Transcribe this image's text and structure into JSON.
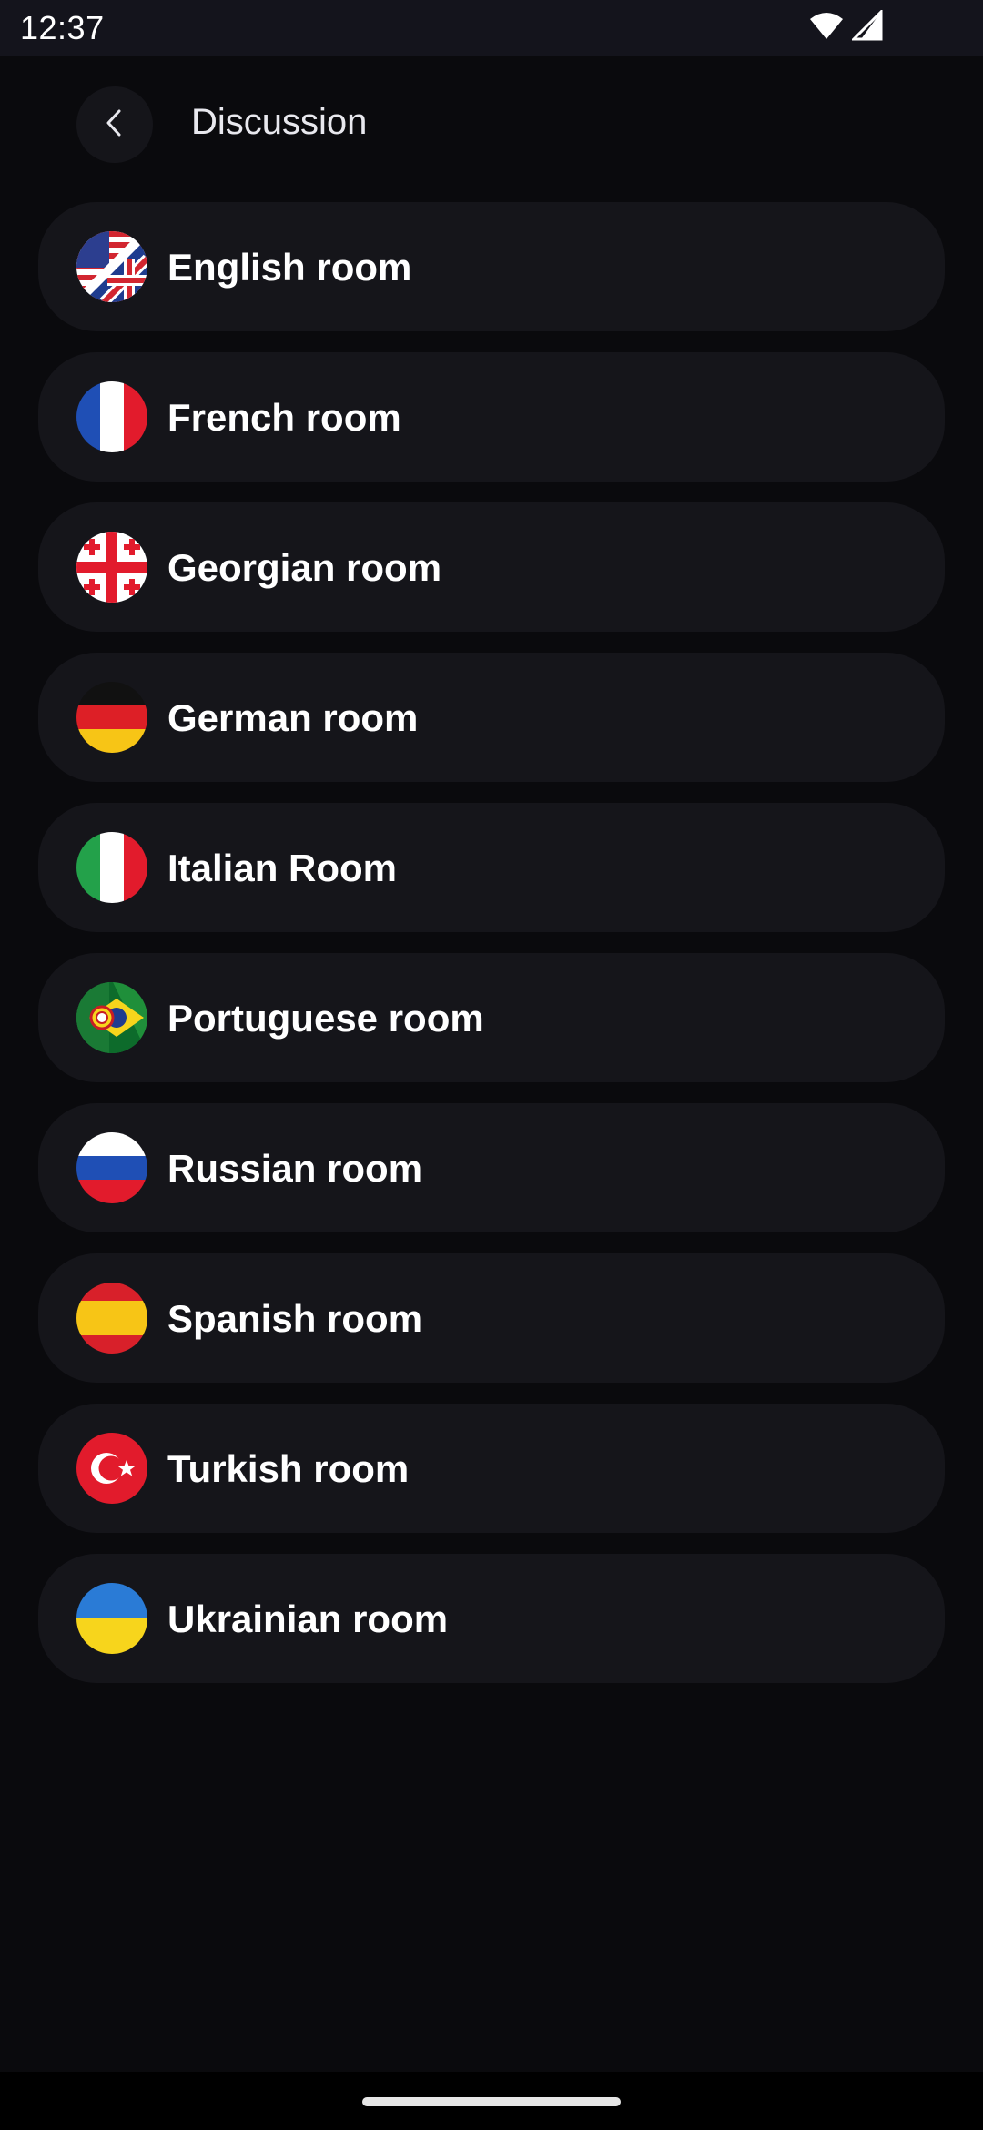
{
  "status_bar": {
    "time": "12:37",
    "icons": [
      "wifi-icon",
      "signal-icon"
    ]
  },
  "header": {
    "back_icon": "chevron-left-icon",
    "title": "Discussion"
  },
  "rooms": [
    {
      "label": "English room",
      "flag": "us-uk-flag-icon"
    },
    {
      "label": "French room",
      "flag": "france-flag-icon"
    },
    {
      "label": "Georgian room",
      "flag": "georgia-flag-icon"
    },
    {
      "label": "German room",
      "flag": "germany-flag-icon"
    },
    {
      "label": "Italian Room",
      "flag": "italy-flag-icon"
    },
    {
      "label": "Portuguese room",
      "flag": "portugal-brazil-flag-icon"
    },
    {
      "label": "Russian room",
      "flag": "russia-flag-icon"
    },
    {
      "label": "Spanish room",
      "flag": "spain-flag-icon"
    },
    {
      "label": "Turkish room",
      "flag": "turkey-flag-icon"
    },
    {
      "label": "Ukrainian room",
      "flag": "ukraine-flag-icon"
    }
  ],
  "colors": {
    "background": "#0a0a0d",
    "card": "#15151a",
    "text": "#ffffff"
  }
}
